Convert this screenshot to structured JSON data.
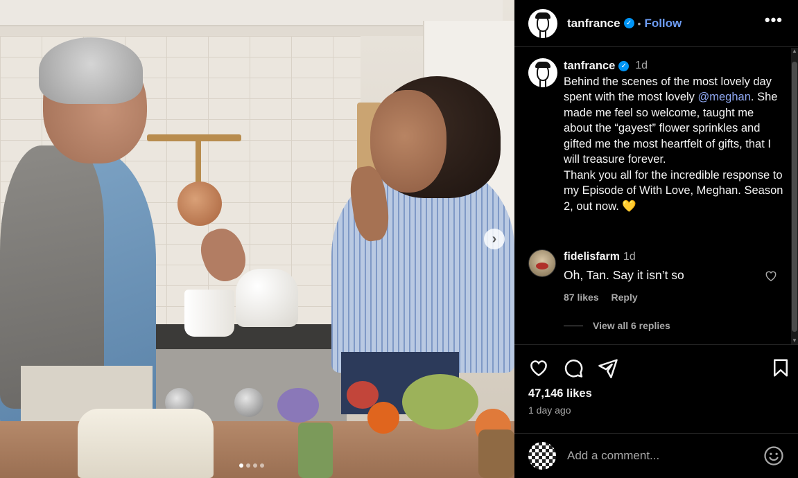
{
  "post": {
    "username": "tanfrance",
    "follow_label": "Follow",
    "separator": "•",
    "more_label": "•••"
  },
  "caption": {
    "username": "tanfrance",
    "time": "1d",
    "text_before_mention": "Behind the scenes of the most lovely day spent with the most lovely ",
    "mention": "@meghan",
    "text_after_mention": ". She made me feel so welcome, taught me about the “gayest” flower sprinkles and gifted me the most heartfelt of gifts, that I will treasure forever.",
    "text_line2": "Thank you all for the incredible response to my Episode of With Love, Meghan. Season 2, out now. ",
    "emoji": "💛"
  },
  "comment": {
    "username": "fidelisfarm",
    "time": "1d",
    "text": "Oh, Tan. Say it isn’t so",
    "likes": "87 likes",
    "reply_label": "Reply",
    "view_replies": "View all 6 replies"
  },
  "engagement": {
    "likes": "47,146 likes",
    "ago": "1 day ago"
  },
  "composer": {
    "placeholder": "Add a comment..."
  },
  "carousel": {
    "next_label": "›",
    "dot_count": 4,
    "active_dot": 1
  },
  "icons": {
    "like": "heart-icon",
    "comment": "comment-bubble-icon",
    "share": "paper-plane-icon",
    "save": "bookmark-icon",
    "emoji": "smiley-icon",
    "verified": "verified-badge-icon",
    "more": "more-options-icon"
  },
  "colors": {
    "link": "#6d9cf3",
    "verified": "#0095f6",
    "muted": "#a8a8a8",
    "text": "#f5f5f5",
    "background": "#000000"
  }
}
